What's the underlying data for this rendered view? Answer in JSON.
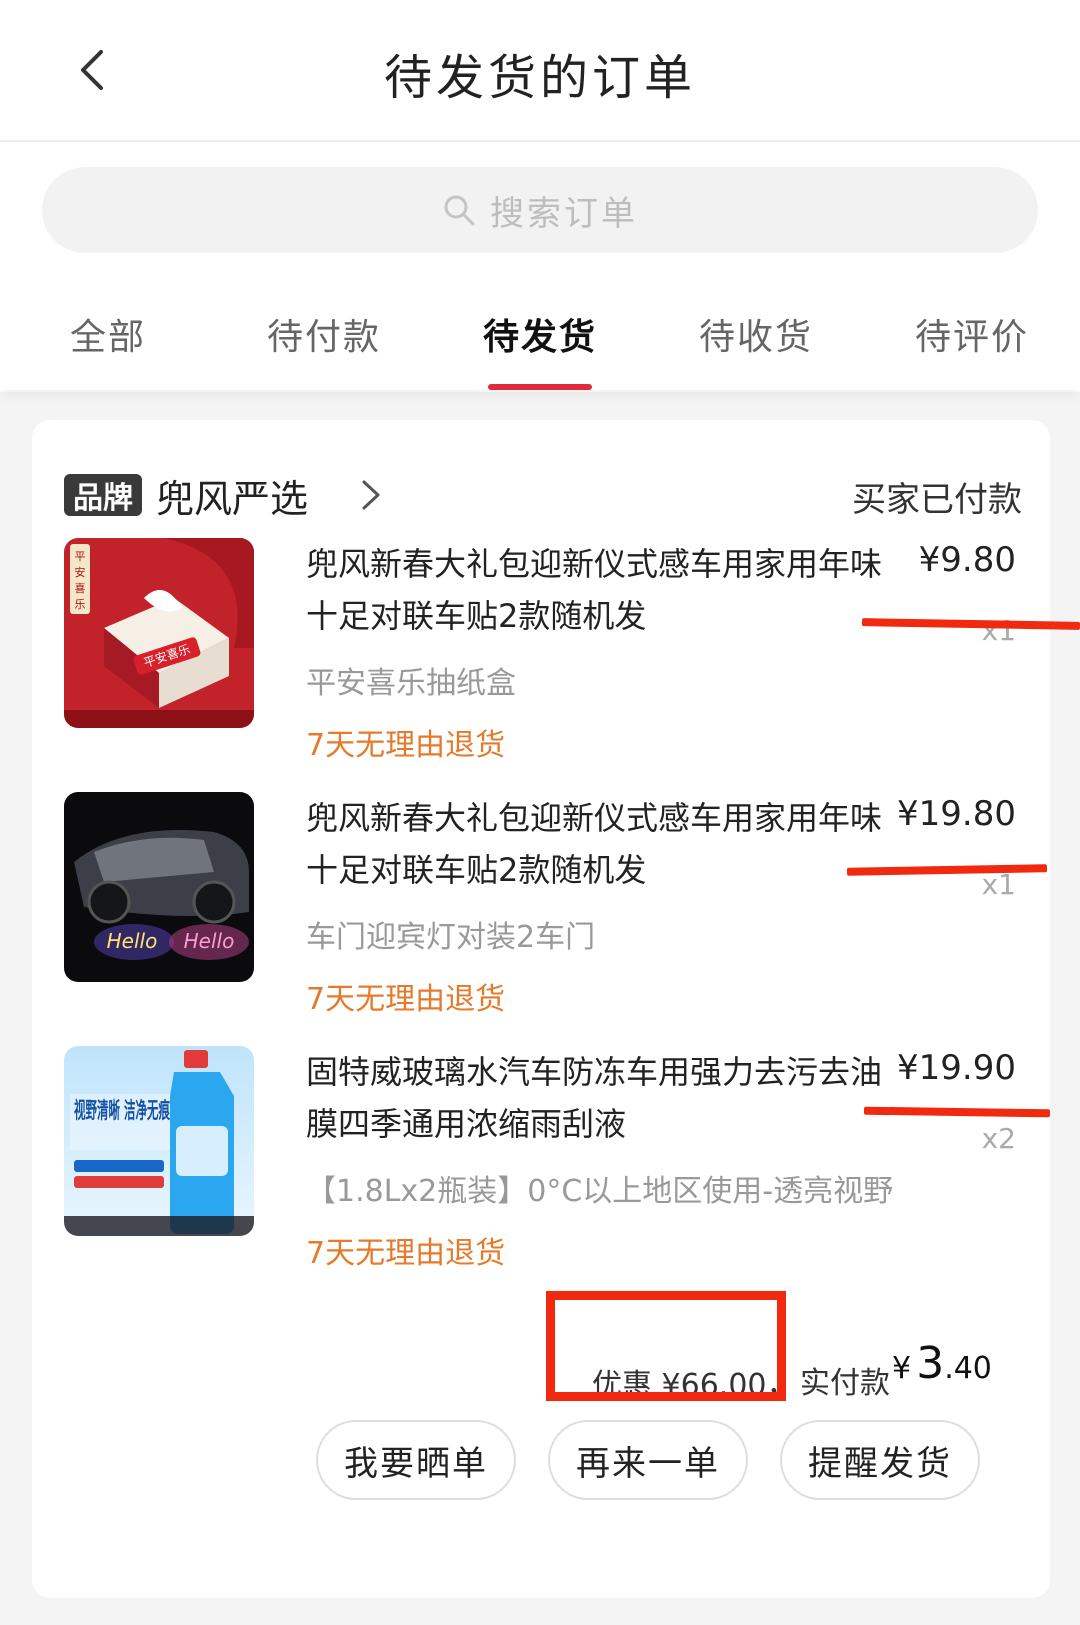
{
  "header": {
    "title": "待发货的订单"
  },
  "search": {
    "placeholder": "搜索订单"
  },
  "tabs": [
    {
      "label": "全部"
    },
    {
      "label": "待付款"
    },
    {
      "label": "待发货",
      "active": true
    },
    {
      "label": "待收货"
    },
    {
      "label": "待评价"
    }
  ],
  "order": {
    "brand_badge": "品牌",
    "shop_name": "兜风严选",
    "status": "买家已付款",
    "items": [
      {
        "title": "兜风新春大礼包迎新仪式感车用家用年味十足对联车贴2款随机发",
        "variant": "平安喜乐抽纸盒",
        "return_policy": "7天无理由退货",
        "price": "¥9.80",
        "qty": "x1",
        "thumb_text": "平安喜乐"
      },
      {
        "title": "兜风新春大礼包迎新仪式感车用家用年味十足对联车贴2款随机发",
        "variant": "车门迎宾灯对装2车门",
        "return_policy": "7天无理由退货",
        "price": "¥19.80",
        "qty": "x1",
        "thumb_text": "Hello"
      },
      {
        "title": "固特威玻璃水汽车防冻车用强力去污去油膜四季通用浓缩雨刮液",
        "variant": "【1.8Lx2瓶装】0°C以上地区使用-透亮视野",
        "return_policy": "7天无理由退货",
        "price": "¥19.90",
        "qty": "x2",
        "thumb_text": "视野清晰 洁净无痕"
      }
    ],
    "discount": "优惠 ¥66.00，",
    "paid_label": "实付款",
    "paid_yen": "¥",
    "paid_integer": "3",
    "paid_decimal": ".40",
    "actions": [
      "我要晒单",
      "再来一单",
      "提醒发货"
    ]
  },
  "colors": {
    "accent": "#e22a3d",
    "annotation_red": "#f0290f",
    "return_orange": "#e67a2b"
  }
}
